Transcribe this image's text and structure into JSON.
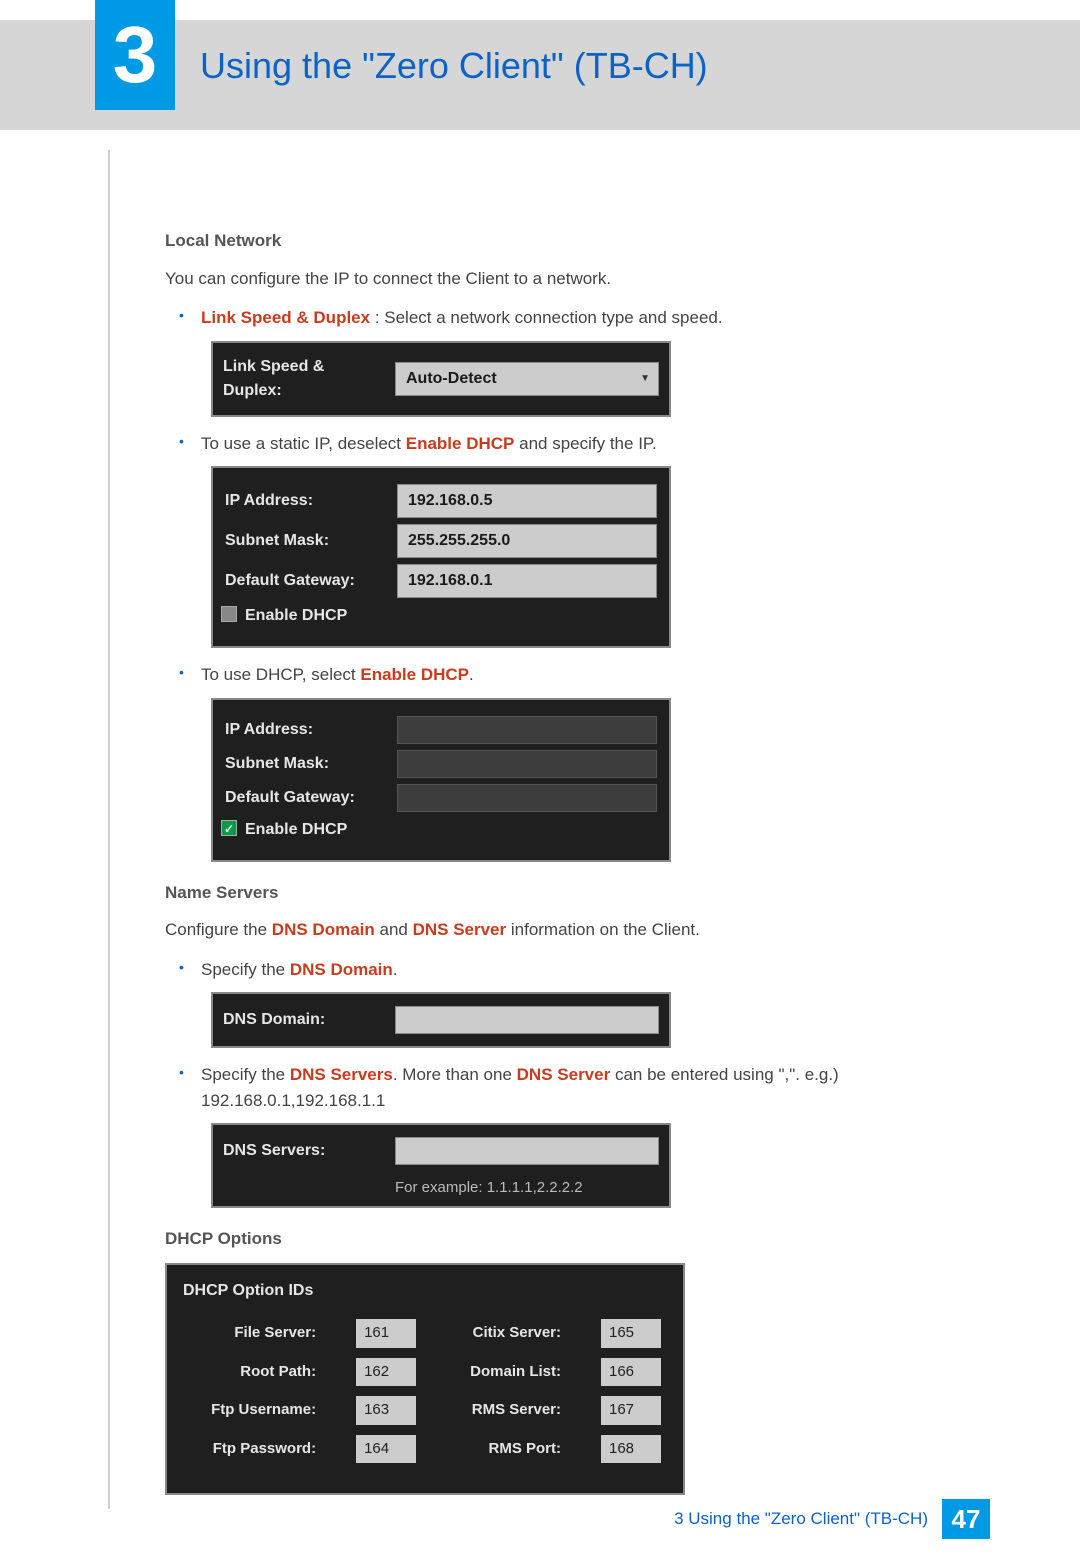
{
  "chapter": {
    "number": "3",
    "title": "Using the \"Zero Client\" (TB-CH)"
  },
  "sections": {
    "local_network": {
      "heading": "Local Network",
      "intro": "You can configure the IP to connect the Client to a network.",
      "bullet_link_speed": {
        "label": "Link Speed & Duplex",
        "text": " : Select a network connection type and speed."
      },
      "bullet_static_pre": "To use a static IP, deselect ",
      "bullet_static_bold": "Enable DHCP",
      "bullet_static_post": " and specify the IP.",
      "bullet_dhcp_pre": "To use DHCP, select ",
      "bullet_dhcp_bold": "Enable DHCP",
      "bullet_dhcp_post": "."
    },
    "name_servers": {
      "heading": "Name Servers",
      "intro_pre": "Configure the ",
      "intro_b1": "DNS Domain",
      "intro_mid": " and ",
      "intro_b2": "DNS Server",
      "intro_post": " information on the Client.",
      "bullet_domain_pre": "Specify the ",
      "bullet_domain_bold": "DNS Domain",
      "bullet_domain_post": ".",
      "bullet_servers_pre": "Specify the ",
      "bullet_servers_bold": "DNS Servers",
      "bullet_servers_mid": ". More than one ",
      "bullet_servers_bold2": "DNS Server",
      "bullet_servers_post": " can be entered using \",\". e.g.)",
      "bullet_servers_example": "192.168.0.1,192.168.1.1"
    },
    "dhcp_options": {
      "heading": "DHCP Options"
    }
  },
  "ss_linkspeed": {
    "label": "Link Speed & Duplex:",
    "value": "Auto-Detect"
  },
  "ss_static": {
    "ip_label": "IP Address:",
    "ip_value": "192.168.0.5",
    "mask_label": "Subnet Mask:",
    "mask_value": "255.255.255.0",
    "gw_label": "Default Gateway:",
    "gw_value": "192.168.0.1",
    "dhcp_label": "Enable DHCP"
  },
  "ss_dhcp": {
    "ip_label": "IP Address:",
    "mask_label": "Subnet Mask:",
    "gw_label": "Default Gateway:",
    "dhcp_label": "Enable DHCP"
  },
  "ss_dnsdomain": {
    "label": "DNS Domain:"
  },
  "ss_dnsservers": {
    "label": "DNS Servers:",
    "example": "For example: 1.1.1.1,2.2.2.2"
  },
  "ss_dhcpopts": {
    "header": "DHCP Option IDs",
    "rows": [
      {
        "l1": "File Server:",
        "v1": "161",
        "l2": "Citix Server:",
        "v2": "165"
      },
      {
        "l1": "Root Path:",
        "v1": "162",
        "l2": "Domain List:",
        "v2": "166"
      },
      {
        "l1": "Ftp Username:",
        "v1": "163",
        "l2": "RMS Server:",
        "v2": "167"
      },
      {
        "l1": "Ftp Password:",
        "v1": "164",
        "l2": "RMS Port:",
        "v2": "168"
      }
    ]
  },
  "footer": {
    "text": "3 Using the \"Zero Client\" (TB-CH)",
    "page": "47"
  }
}
